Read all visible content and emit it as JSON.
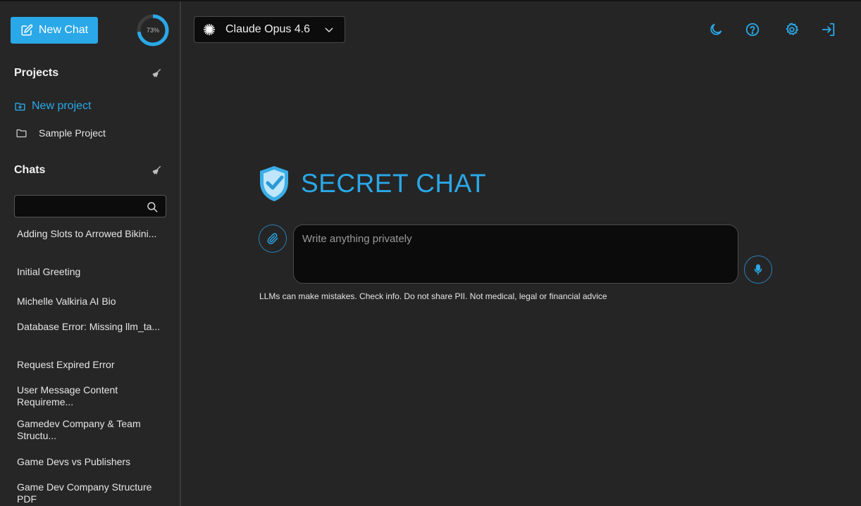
{
  "sidebar": {
    "new_chat_label": "New Chat",
    "usage_percent": 73,
    "usage_label": "73%",
    "projects_title": "Projects",
    "new_project_label": "New project",
    "projects": [
      {
        "name": "Sample Project"
      }
    ],
    "chats_title": "Chats",
    "search_value": "",
    "chats": [
      {
        "title": "Adding Slots to Arrowed Bikini..."
      },
      {
        "title": "Initial Greeting"
      },
      {
        "title": "Michelle Valkiria AI Bio"
      },
      {
        "title": "Database Error: Missing llm_ta..."
      },
      {
        "title": "Request Expired Error"
      },
      {
        "title": "User Message Content Requireme..."
      },
      {
        "title": "Gamedev Company & Team Structu..."
      },
      {
        "title": "Game Devs vs Publishers"
      },
      {
        "title": "Game Dev Company Structure PDF"
      }
    ]
  },
  "header": {
    "model_name": "Claude Opus 4.6"
  },
  "main": {
    "brand_text": "SECRET CHAT",
    "composer_placeholder": "Write anything privately",
    "disclaimer": "LLMs can make mistakes. Check info. Do not share PII. Not medical, legal or financial advice"
  },
  "colors": {
    "accent": "#2aa8e8",
    "background": "#252525",
    "input_background": "#0b0b0b"
  },
  "icons": {
    "new_chat": "edit-icon",
    "clear_projects": "broom-icon",
    "new_project": "folder-plus-icon",
    "project": "folder-icon",
    "clear_chats": "broom-icon",
    "search": "search-icon",
    "model": "sparkle-icon",
    "model_dropdown": "chevron-down-icon",
    "theme": "moon-icon",
    "help": "help-icon",
    "settings": "gear-icon",
    "logout": "logout-icon",
    "brand": "shield-check-icon",
    "attach": "paperclip-icon",
    "mic": "microphone-icon"
  }
}
